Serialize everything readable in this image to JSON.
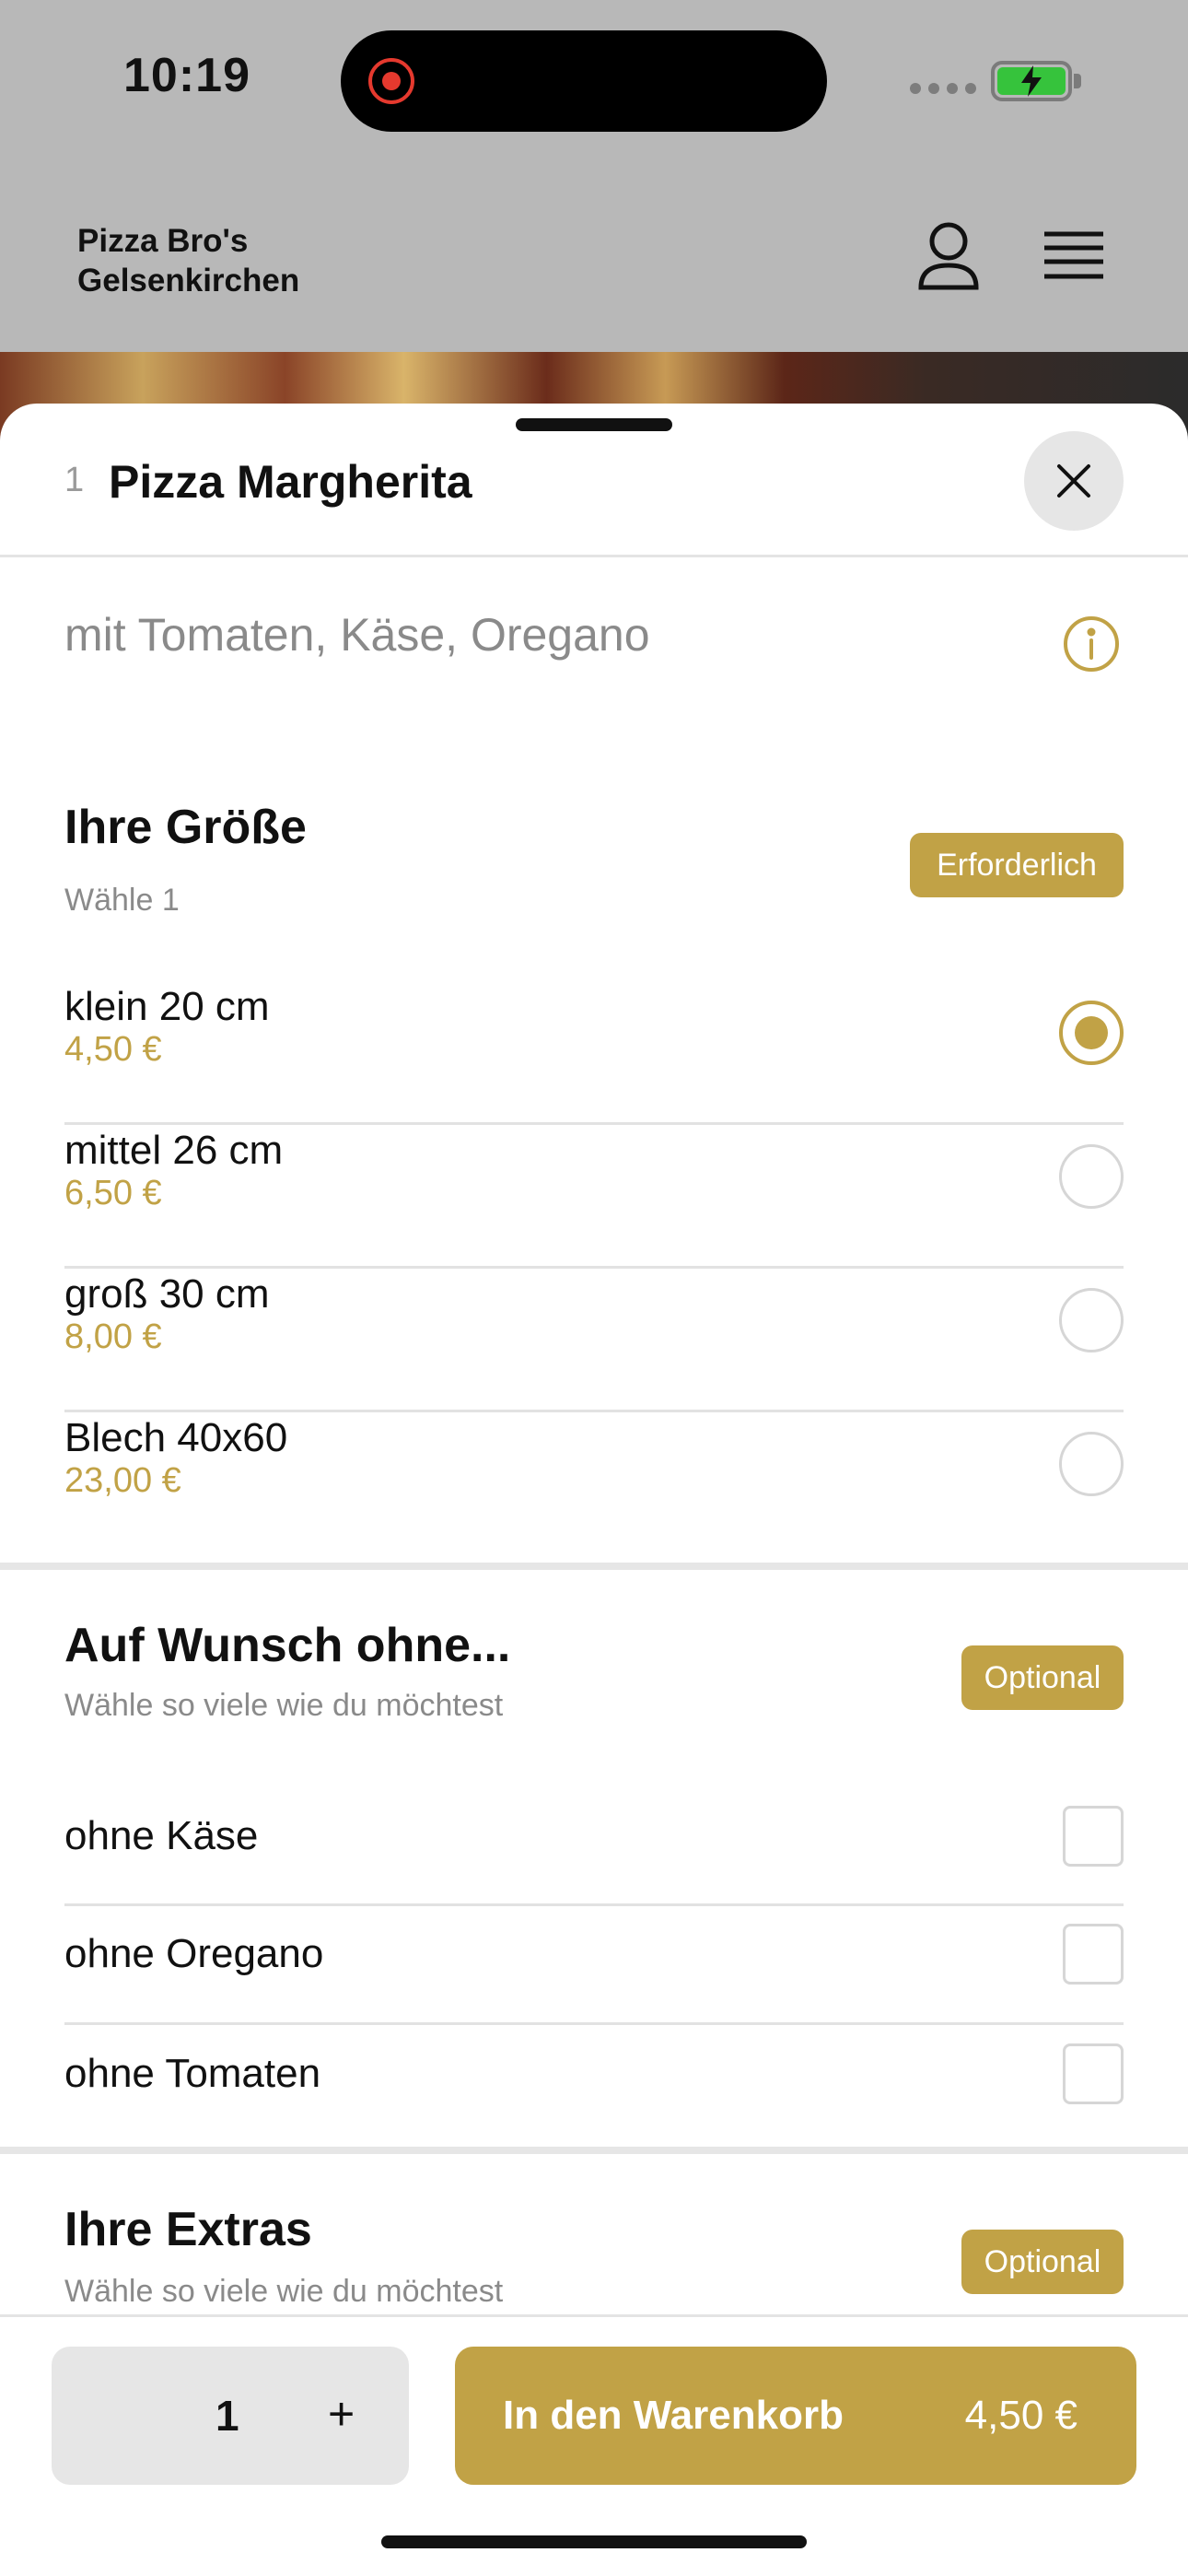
{
  "status_bar": {
    "time": "10:19"
  },
  "header": {
    "brand_line1": "Pizza Bro's",
    "brand_line2": "Gelsenkirchen"
  },
  "sheet": {
    "item_number": "1",
    "title": "Pizza Margherita",
    "description": "mit Tomaten, Käse, Oregano"
  },
  "size_section": {
    "title": "Ihre Größe",
    "subtitle": "Wähle 1",
    "badge": "Erforderlich",
    "options": [
      {
        "name": "klein 20 cm",
        "price": "4,50 €",
        "selected": true
      },
      {
        "name": "mittel 26 cm",
        "price": "6,50 €",
        "selected": false
      },
      {
        "name": "groß 30 cm",
        "price": "8,00 €",
        "selected": false
      },
      {
        "name": "Blech 40x60",
        "price": "23,00 €",
        "selected": false
      }
    ]
  },
  "without_section": {
    "title": "Auf Wunsch  ohne...",
    "subtitle": "Wähle so viele wie du möchtest",
    "badge": "Optional",
    "options": [
      {
        "name": "ohne Käse",
        "checked": false
      },
      {
        "name": "ohne Oregano",
        "checked": false
      },
      {
        "name": "ohne Tomaten",
        "checked": false
      }
    ]
  },
  "extras_section": {
    "title": "Ihre Extras",
    "subtitle": "Wähle so viele wie du möchtest",
    "badge": "Optional"
  },
  "bottom_bar": {
    "quantity": "1",
    "plus": "+",
    "cart_label": "In den Warenkorb",
    "cart_price": "4,50 €"
  },
  "colors": {
    "accent": "#c1a246",
    "overlay": "#b8b8b8"
  },
  "icons": {
    "user": "user-icon",
    "menu": "menu-icon",
    "close": "close-icon",
    "info": "info-icon"
  }
}
